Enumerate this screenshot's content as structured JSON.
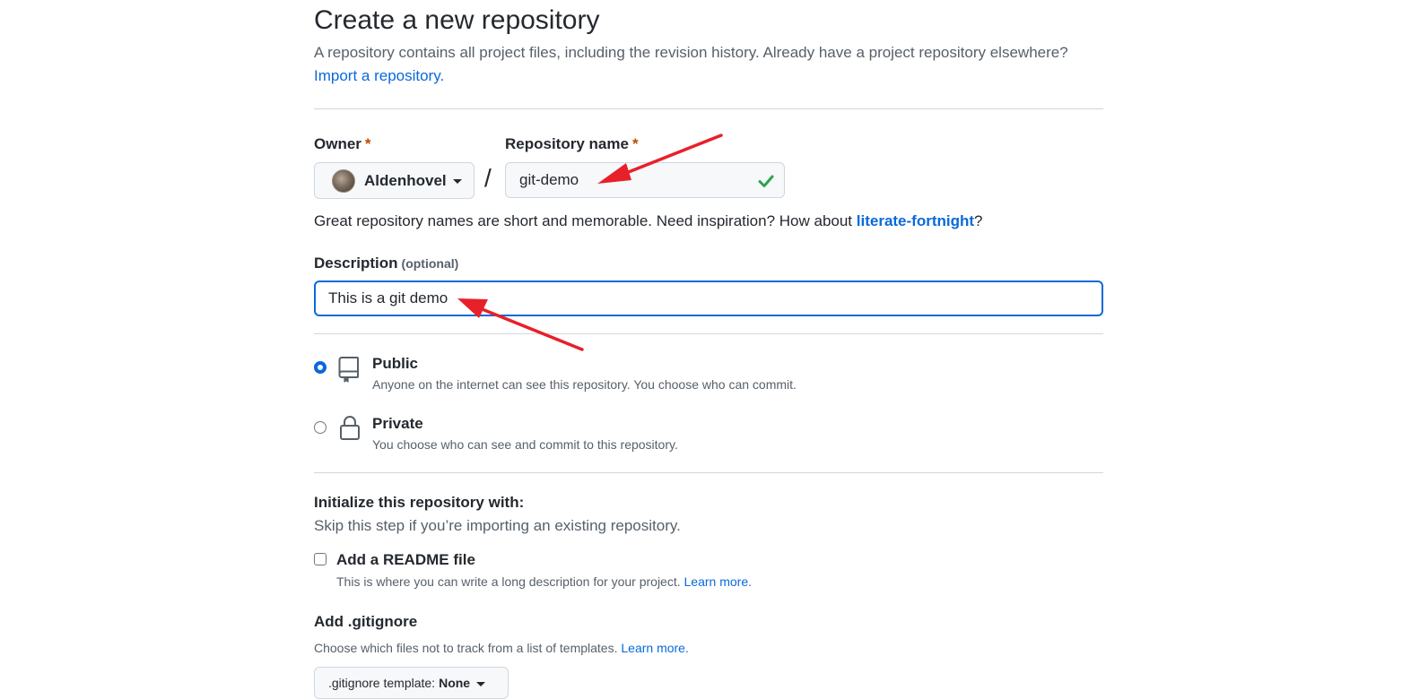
{
  "page": {
    "title": "Create a new repository",
    "subtitle": "A repository contains all project files, including the revision history. Already have a project repository elsewhere?",
    "import_link": "Import a repository."
  },
  "owner": {
    "label": "Owner",
    "required_mark": "*",
    "selected": "Aldenhovel"
  },
  "separator": "/",
  "repo_name": {
    "label": "Repository name",
    "required_mark": "*",
    "value": "git-demo",
    "valid": true
  },
  "name_hint": {
    "prefix": "Great repository names are short and memorable. Need inspiration? How about ",
    "suggestion": "literate-fortnight",
    "suffix": "?"
  },
  "description": {
    "label": "Description",
    "optional": "(optional)",
    "value": "This is a git demo"
  },
  "visibility": {
    "public": {
      "title": "Public",
      "desc": "Anyone on the internet can see this repository. You choose who can commit.",
      "selected": true,
      "icon": "repo-icon"
    },
    "private": {
      "title": "Private",
      "desc": "You choose who can see and commit to this repository.",
      "selected": false,
      "icon": "lock-icon"
    }
  },
  "initialize": {
    "title": "Initialize this repository with:",
    "subtitle": "Skip this step if you’re importing an existing repository.",
    "readme": {
      "label": "Add a README file",
      "desc": "This is where you can write a long description for your project.",
      "link": "Learn more.",
      "checked": false
    }
  },
  "gitignore": {
    "title": "Add .gitignore",
    "desc": "Choose which files not to track from a list of templates.",
    "link": "Learn more.",
    "button_prefix": ".gitignore template:",
    "button_value": "None"
  },
  "colors": {
    "accent": "#0969da",
    "success": "#2da44e",
    "required": "#bc4c00",
    "annotation_arrow": "#e8202a"
  }
}
